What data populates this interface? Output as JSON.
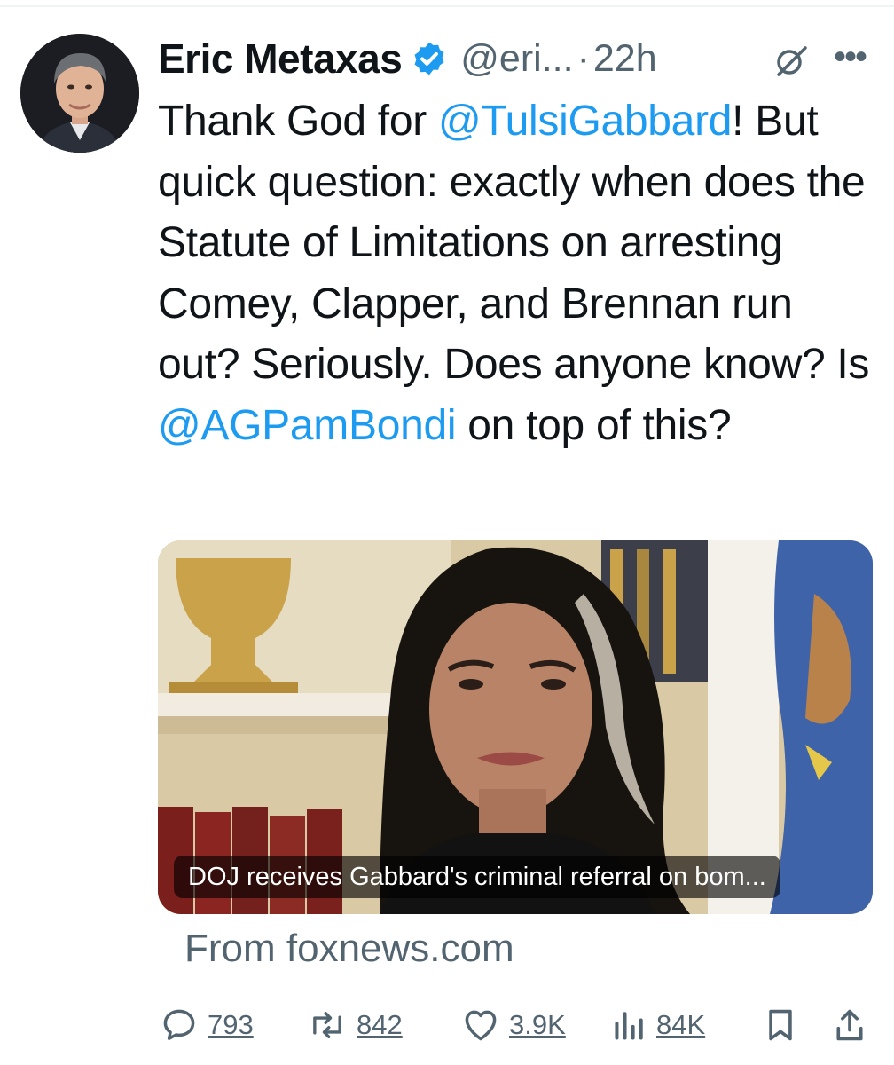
{
  "author": {
    "name": "Eric Metaxas",
    "handle": "@eri...",
    "separator": "·",
    "time": "22h",
    "verified": true,
    "avatar_icon": "profile-photo"
  },
  "tweet": {
    "segments": [
      {
        "text": "Thank God for ",
        "type": "text"
      },
      {
        "text": "@TulsiGabbard",
        "type": "mention"
      },
      {
        "text": "! But quick question: exactly when does the Statute of Limitations on arresting Comey, Clapper, and Brennan run out? Seriously. Does anyone know? Is ",
        "type": "text"
      },
      {
        "text": "@AGPamBondi",
        "type": "mention"
      },
      {
        "text": " on top of this?",
        "type": "text"
      }
    ]
  },
  "link_card": {
    "caption": "DOJ receives Gabbard's criminal referral on bom...",
    "source": "From foxnews.com"
  },
  "actions": {
    "replies": "793",
    "reposts": "842",
    "likes": "3.9K",
    "views": "84K"
  },
  "colors": {
    "text": "#0f1419",
    "secondary": "#536471",
    "mention": "#1d9bf0",
    "verified": "#1d9bf0"
  }
}
